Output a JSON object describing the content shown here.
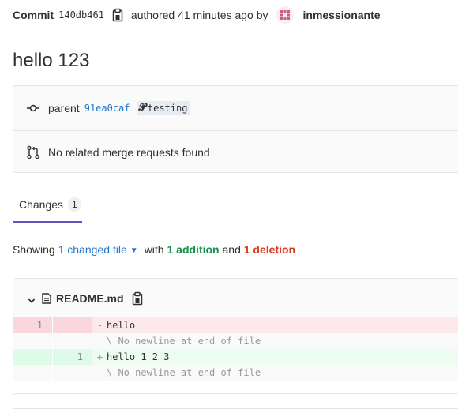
{
  "header": {
    "commit_label": "Commit",
    "sha": "140db461",
    "authored_text": "authored 41 minutes ago by",
    "author": "inmessionante",
    "copy_icon": "clipboard-icon",
    "avatar_icon": "identicon-avatar"
  },
  "title": "hello 123",
  "info": {
    "parent_label": "parent",
    "parent_sha": "91ea0caf",
    "branch": "testing",
    "merge_requests_text": "No related merge requests found",
    "commit_icon": "commit-icon",
    "merge_request_icon": "merge-request-icon",
    "branch_icon": "branch-icon"
  },
  "tabs": [
    {
      "label": "Changes",
      "count": "1"
    }
  ],
  "summary": {
    "showing": "Showing",
    "changed_files": "1 changed file",
    "with": "with",
    "additions": "1 addition",
    "and": "and",
    "deletions": "1 deletion"
  },
  "diff": {
    "filename": "README.md",
    "lines": [
      {
        "type": "del",
        "old": "1",
        "new": "",
        "marker": "-",
        "text": "hello"
      },
      {
        "type": "nl",
        "old": "",
        "new": "",
        "marker": "",
        "text": "\\ No newline at end of file"
      },
      {
        "type": "add",
        "old": "",
        "new": "1",
        "marker": "+",
        "text": "hello 1 2 3"
      },
      {
        "type": "nl",
        "old": "",
        "new": "",
        "marker": "",
        "text": "\\ No newline at end of file"
      }
    ]
  },
  "colors": {
    "accent": "#6b4fbb",
    "link": "#1f78d1",
    "addition": "#168f48",
    "deletion": "#db3b21"
  }
}
